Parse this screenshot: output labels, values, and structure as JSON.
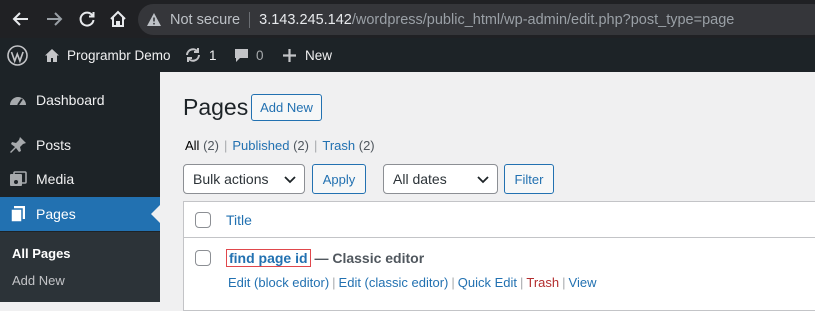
{
  "browser": {
    "security_label": "Not secure",
    "url_host": "3.143.245.142",
    "url_path": "/wordpress/public_html/wp-admin/edit.php?post_type=page"
  },
  "adminbar": {
    "site_name": "Programbr Demo",
    "updates_count": "1",
    "comments_count": "0",
    "new_label": "New"
  },
  "sidebar": {
    "items": [
      {
        "label": "Dashboard",
        "icon": "dashboard-icon"
      },
      {
        "label": "Posts",
        "icon": "pin-icon"
      },
      {
        "label": "Media",
        "icon": "media-icon"
      },
      {
        "label": "Pages",
        "icon": "pages-icon"
      }
    ],
    "submenu": [
      "All Pages",
      "Add New"
    ]
  },
  "main": {
    "title": "Pages",
    "add_new": "Add New",
    "filters": {
      "all": "All",
      "all_count": "(2)",
      "published": "Published",
      "published_count": "(2)",
      "trash": "Trash",
      "trash_count": "(2)"
    },
    "bulk_actions": "Bulk actions",
    "apply": "Apply",
    "dates": "All dates",
    "filter": "Filter",
    "column_title": "Title",
    "row": {
      "title": "find page id",
      "state": "— Classic editor",
      "actions": [
        "Edit (block editor)",
        "Edit (classic editor)",
        "Quick Edit",
        "Trash",
        "View"
      ]
    }
  },
  "colors": {
    "accent": "#2271b1",
    "admin_dark": "#1d2327",
    "trash": "#b32d2e",
    "highlight_box": "#e0474c"
  }
}
